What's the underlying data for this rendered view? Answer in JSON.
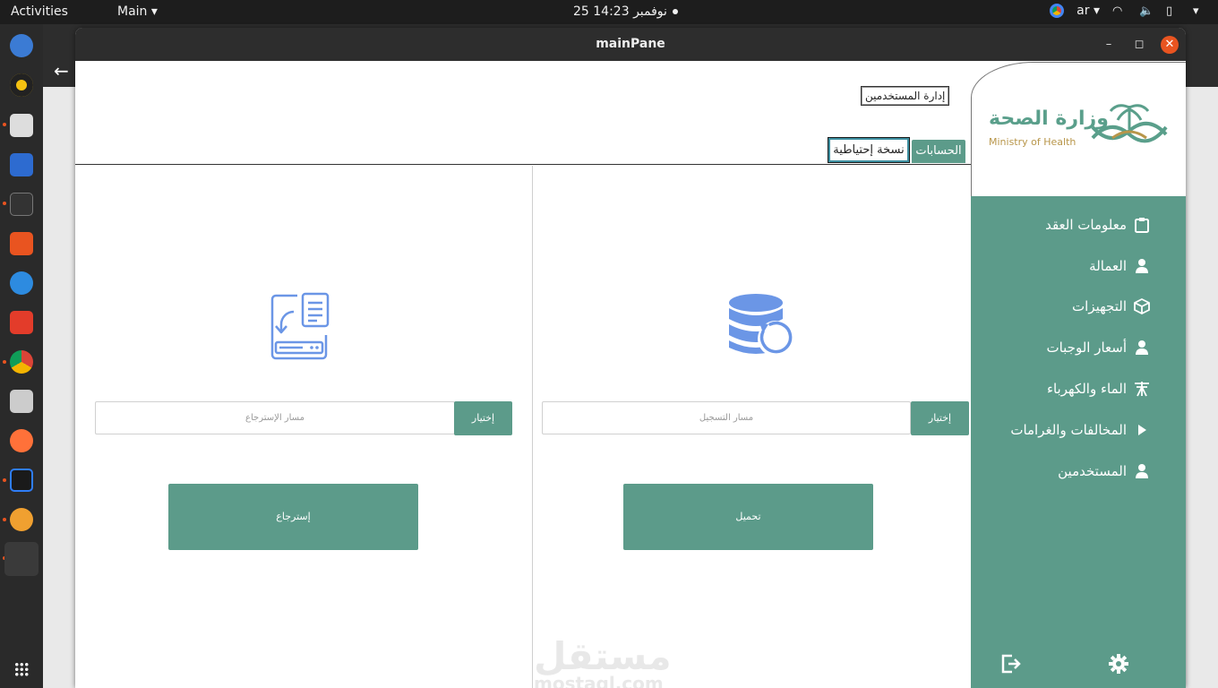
{
  "topbar": {
    "activities": "Activities",
    "app_menu": "Main",
    "clock": "25 نوفمبر  14:23",
    "language": "ar"
  },
  "window": {
    "title": "mainPane"
  },
  "header": {
    "users_button": "إدارة المستخدمين"
  },
  "tabs": [
    {
      "label": "الحسابات"
    },
    {
      "label": "نسخة إحتياطية"
    }
  ],
  "restore_panel": {
    "path_placeholder": "مسار الإسترجاع",
    "choose_label": "إختيار",
    "action_label": "إسترجاع"
  },
  "backup_panel": {
    "path_placeholder": "مسار التسجيل",
    "choose_label": "إختيار",
    "action_label": "تحميل"
  },
  "logo": {
    "arabic": "وزارة الصحة",
    "english": "Ministry of Health"
  },
  "sidebar": {
    "items": [
      {
        "label": "معلومات العقد",
        "icon": "clipboard-icon"
      },
      {
        "label": "العمالة",
        "icon": "user-icon"
      },
      {
        "label": "التجهيزات",
        "icon": "box-icon"
      },
      {
        "label": "أسعار الوجبات",
        "icon": "user-icon"
      },
      {
        "label": "الماء والكهرباء",
        "icon": "tower-icon"
      },
      {
        "label": "المخالفات والغرامات",
        "icon": "play-icon"
      },
      {
        "label": "المستخدمين",
        "icon": "user-icon"
      }
    ]
  },
  "watermark": {
    "arabic": "مستقل",
    "latin": "mostaql.com"
  },
  "colors": {
    "accent": "#5c9b8a",
    "icon_blue": "#6b96e6",
    "close": "#e95420"
  }
}
